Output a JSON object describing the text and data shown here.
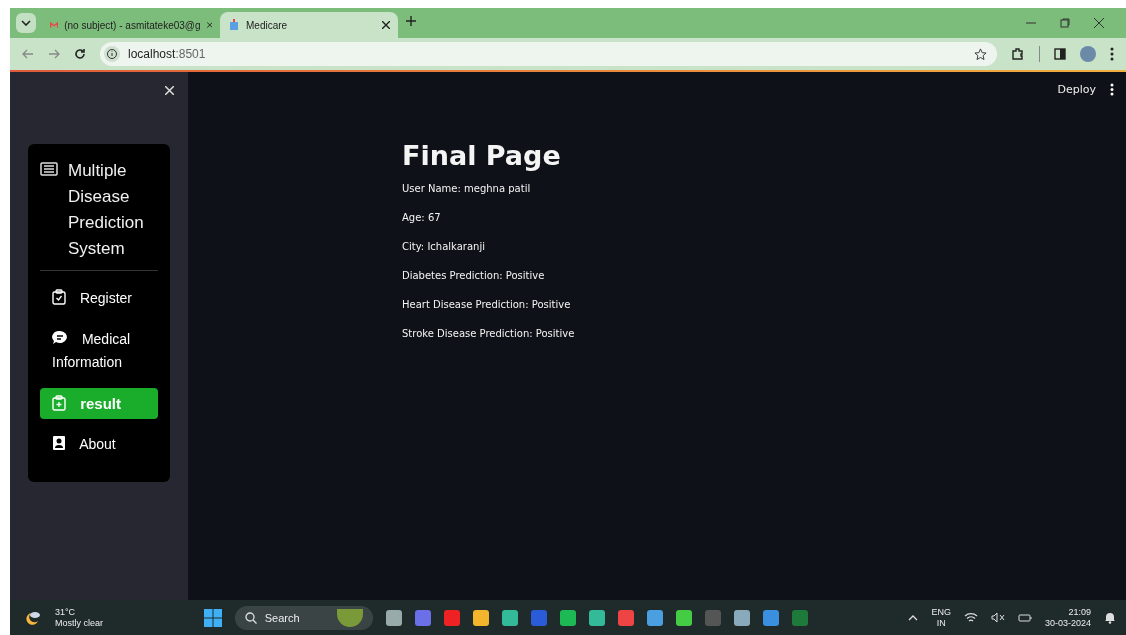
{
  "browser": {
    "tabs": [
      {
        "title": "(no subject) - asmitateke03@g",
        "selected": false
      },
      {
        "title": "Medicare",
        "selected": true
      }
    ],
    "address": "localhost",
    "port": ":8501"
  },
  "app": {
    "deploy": "Deploy",
    "sidebar": {
      "title": "Multiple Disease Prediction System",
      "items": [
        {
          "label": "Register",
          "selected": false
        },
        {
          "label": "Medical Information",
          "selected": false
        },
        {
          "label": "result",
          "selected": true
        },
        {
          "label": "About",
          "selected": false
        }
      ]
    },
    "heading": "Final Page",
    "lines": [
      "User Name: meghna patil",
      "Age: 67",
      "City: Ichalkaranji",
      "Diabetes Prediction: Positive",
      "Heart Disease Prediction: Positive",
      "Stroke Disease Prediction: Positive"
    ]
  },
  "taskbar": {
    "temperature": "31°C",
    "weather": "Mostly clear",
    "search": "Search",
    "language": "ENG",
    "region": "IN",
    "time": "21:09",
    "date": "30-03-2024"
  }
}
